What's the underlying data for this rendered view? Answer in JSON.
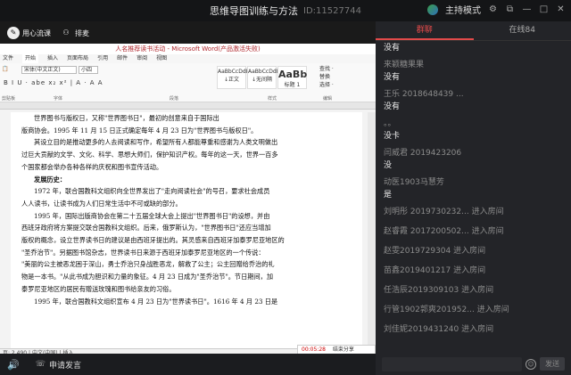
{
  "window": {
    "title": "思维导图训练与方法",
    "room_id": "ID:11527744",
    "host_mode": "主持模式"
  },
  "toolbar": {
    "mode_label": "用心流课",
    "layout_label": "排麦"
  },
  "word": {
    "doc_title": "人名推荐读书活动 - Microsoft Word(产品激活失败)",
    "tabs": [
      "文件",
      "开始",
      "插入",
      "页面布局",
      "引用",
      "邮件",
      "审阅",
      "视图"
    ],
    "clipboard": "剪贴板",
    "font_name": "宋体(中文正文)",
    "font_size": "小四",
    "format_row": "B I U · abe x₂ x² | A · A A",
    "font_group": "字体",
    "para_group": "段落",
    "style_group": "样式",
    "styles": [
      {
        "preview": "AaBbCcDdI",
        "name": "↓正文"
      },
      {
        "preview": "AaBbCcDdI",
        "name": "↓无间隔"
      },
      {
        "preview": "AaBb",
        "name": "标题 1"
      }
    ],
    "change_styles": "更改样式",
    "edit_items": [
      "查找 ·",
      "替换",
      "选择 ·"
    ],
    "edit_group": "编辑",
    "status_left": "页: 2,490 | 中文(中国) | 插入",
    "record_time": "00:05:28",
    "record_share": "结束分享"
  },
  "page": {
    "lines": [
      "世界图书与版权日，又称\"世界图书日\"，最初的创意来自于国际出",
      "版商协会。1995 年 11 月 15 日正式确定每年 4 月 23 日为\"世界图书与版权日\"。",
      "其设立目的是推动更多的人去阅读和写作，希望所有人都能尊重和感谢为人类文明做出",
      "过巨大贡献的文学、文化、科学、思想大师们，保护知识产权。每年的这一天，世界一百多",
      "个国家都会举办各种各样的庆祝和图书宣传活动。",
      "发展历史：",
      "1972 年，联合国教科文组织向全世界发出了\"走向阅读社会\"的号召，要求社会成员",
      "人人读书，让读书成为人们日常生活中不可或缺的部分。",
      "1995 年，国际出版商协会在第二十五届全球大会上提出\"世界图书日\"的设想，并由",
      "西班牙政府将方案提交联合国教科文组织。后来，俄罗斯认为，\"世界图书日\"还应当增加",
      "版权的概念，设立世界读书日的建议是由西班牙提出的。其灵感来自西班牙加泰罗尼亚地区的",
      "\"圣乔治节\"。另据图书馆杂志，世界读书日来源于西班牙加泰罗尼亚地区的一个传说：",
      "\"美丽的公主被恶龙困于深山，勇士乔治只身战胜恶龙，解救了公主；公主回赠给乔治的礼",
      "物是一本书。\"从此书成为胆识和力量的象征。4 月 23 日成为\"圣乔治节\"。节日期间，加",
      "泰罗尼亚地区的居民有赠送玫瑰和图书给亲友的习俗。",
      "1995 年，联合国教科文组织宣布 4 月 23 日为\"世界读书日\"。1616 年 4 月 23 日是"
    ]
  },
  "bottom": {
    "apply_speak": "申请发言"
  },
  "chat": {
    "tabs": [
      "群聊",
      "在线84"
    ],
    "messages": [
      {
        "user": "",
        "text": "没有"
      },
      {
        "user": "来颖糖果果",
        "text": "没有"
      },
      {
        "user": "王乐 2018648439 ...",
        "text": "没有"
      },
      {
        "user": "。。",
        "text": "没卡"
      },
      {
        "user": "闫威君 2019423206",
        "text": "没"
      },
      {
        "user": "动医1903马慧芳",
        "text": "是"
      }
    ],
    "joins": [
      "刘明彤 2019730232... 进入房间",
      "赵睿霞 2017200502... 进入房间",
      "赵雯2019729304 进入房间",
      "苗鑫2019401217 进入房间",
      "任浩辰2019309103 进入房间",
      "行管1902郭爽201952... 进入房间",
      "刘佳妮2019431240 进入房间"
    ],
    "send_label": "发送"
  }
}
